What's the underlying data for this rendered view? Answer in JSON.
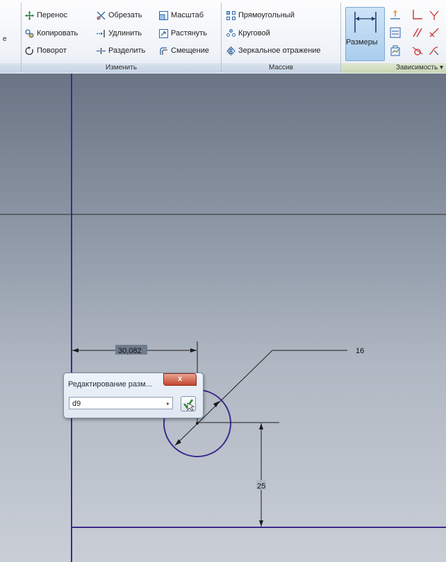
{
  "ribbon": {
    "left_clip": "е",
    "modify": {
      "col1": [
        "Перенос",
        "Копировать",
        "Поворот"
      ],
      "col2": [
        "Обрезать",
        "Удлинить",
        "Разделить"
      ],
      "col3": [
        "Масштаб",
        "Растянуть",
        "Смещение"
      ],
      "label": "Изменить"
    },
    "pattern": {
      "items": [
        "Прямоугольный",
        "Круговой",
        "Зеркальное отражение"
      ],
      "label": "Массив"
    },
    "constrain": {
      "dimension_button": "Размеры",
      "label": "Зависимость ▾"
    }
  },
  "sketch": {
    "dim_horizontal": "30,082",
    "dim_diameter": "16",
    "dim_vertical": "25"
  },
  "dialog": {
    "title": "Редактирование разм...",
    "close": "x",
    "value": "d9",
    "arrow": "▸"
  },
  "colors": {
    "sketch_line": "#3b2a8c",
    "dim_line": "#1a1a1a",
    "ribbon_bar": "#c6d3e3",
    "close_button": "#c4462f"
  }
}
